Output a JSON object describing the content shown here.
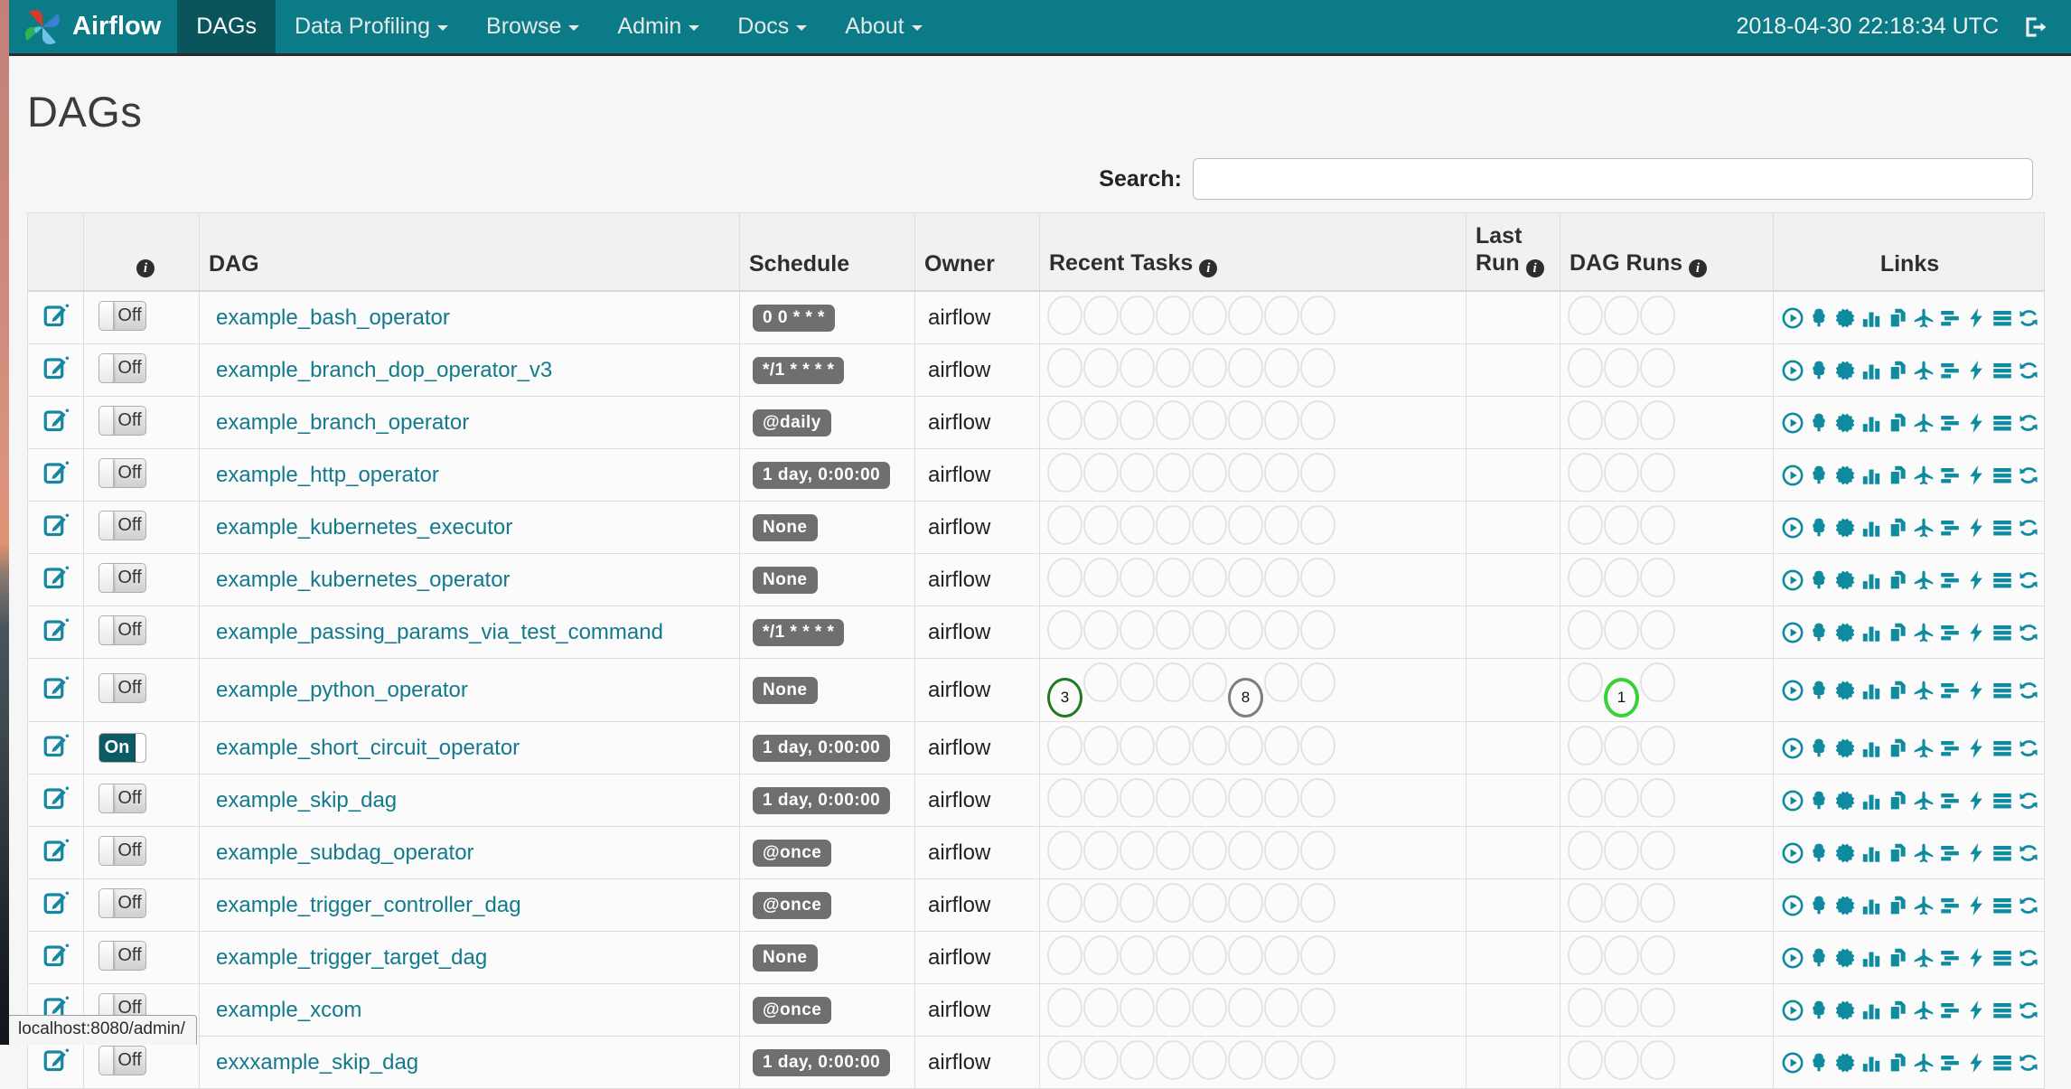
{
  "navbar": {
    "brand": "Airflow",
    "items": [
      {
        "label": "DAGs",
        "active": true,
        "caret": false
      },
      {
        "label": "Data Profiling",
        "active": false,
        "caret": true
      },
      {
        "label": "Browse",
        "active": false,
        "caret": true
      },
      {
        "label": "Admin",
        "active": false,
        "caret": true
      },
      {
        "label": "Docs",
        "active": false,
        "caret": true
      },
      {
        "label": "About",
        "active": false,
        "caret": true
      }
    ],
    "clock": "2018-04-30 22:18:34 UTC",
    "logout_icon": "logout-icon"
  },
  "page": {
    "title": "DAGs",
    "search_label": "Search:",
    "search_value": "",
    "search_placeholder": "",
    "status_bar": "localhost:8080/admin/"
  },
  "colors": {
    "navbar_teal": "#0b7c87",
    "navbar_active": "#0a545c",
    "link_teal": "#127a8c",
    "icon_teal": "#0f8ba0",
    "badge_gray": "#6f6f6f",
    "success_green": "#1f7a1f",
    "shutdown_gray": "#7d7d7d",
    "running_green": "#38d138"
  },
  "table": {
    "headers": {
      "info": "i",
      "dag": "DAG",
      "schedule": "Schedule",
      "owner": "Owner",
      "recent_tasks": "Recent Tasks",
      "last_run_line1": "Last",
      "last_run_line2": "Run",
      "dag_runs": "DAG Runs",
      "links": "Links"
    },
    "link_icons": [
      "trigger",
      "tree",
      "graph",
      "duration",
      "tries",
      "landing",
      "gantt",
      "code",
      "logs",
      "refresh"
    ],
    "recent_task_slots": 8,
    "dag_run_slots": 3,
    "rows": [
      {
        "name": "example_bash_operator",
        "toggle": "Off",
        "schedule": "0 0 * * *",
        "owner": "airflow",
        "last_run": "",
        "recent_tasks": [
          null,
          null,
          null,
          null,
          null,
          null,
          null,
          null
        ],
        "dag_runs": [
          null,
          null,
          null
        ]
      },
      {
        "name": "example_branch_dop_operator_v3",
        "toggle": "Off",
        "schedule": "*/1 * * * *",
        "owner": "airflow",
        "last_run": "",
        "recent_tasks": [
          null,
          null,
          null,
          null,
          null,
          null,
          null,
          null
        ],
        "dag_runs": [
          null,
          null,
          null
        ]
      },
      {
        "name": "example_branch_operator",
        "toggle": "Off",
        "schedule": "@daily",
        "owner": "airflow",
        "last_run": "",
        "recent_tasks": [
          null,
          null,
          null,
          null,
          null,
          null,
          null,
          null
        ],
        "dag_runs": [
          null,
          null,
          null
        ]
      },
      {
        "name": "example_http_operator",
        "toggle": "Off",
        "schedule": "1 day, 0:00:00",
        "owner": "airflow",
        "last_run": "",
        "recent_tasks": [
          null,
          null,
          null,
          null,
          null,
          null,
          null,
          null
        ],
        "dag_runs": [
          null,
          null,
          null
        ]
      },
      {
        "name": "example_kubernetes_executor",
        "toggle": "Off",
        "schedule": "None",
        "owner": "airflow",
        "last_run": "",
        "recent_tasks": [
          null,
          null,
          null,
          null,
          null,
          null,
          null,
          null
        ],
        "dag_runs": [
          null,
          null,
          null
        ]
      },
      {
        "name": "example_kubernetes_operator",
        "toggle": "Off",
        "schedule": "None",
        "owner": "airflow",
        "last_run": "",
        "recent_tasks": [
          null,
          null,
          null,
          null,
          null,
          null,
          null,
          null
        ],
        "dag_runs": [
          null,
          null,
          null
        ]
      },
      {
        "name": "example_passing_params_via_test_command",
        "toggle": "Off",
        "schedule": "*/1 * * * *",
        "owner": "airflow",
        "last_run": "",
        "recent_tasks": [
          null,
          null,
          null,
          null,
          null,
          null,
          null,
          null
        ],
        "dag_runs": [
          null,
          null,
          null
        ]
      },
      {
        "name": "example_python_operator",
        "toggle": "Off",
        "schedule": "None",
        "owner": "airflow",
        "last_run": "",
        "recent_tasks": [
          {
            "value": "3",
            "state": "success"
          },
          null,
          null,
          null,
          null,
          {
            "value": "8",
            "state": "shutdown"
          },
          null,
          null
        ],
        "dag_runs": [
          null,
          {
            "value": "1",
            "state": "running"
          },
          null
        ]
      },
      {
        "name": "example_short_circuit_operator",
        "toggle": "On",
        "schedule": "1 day, 0:00:00",
        "owner": "airflow",
        "last_run": "",
        "recent_tasks": [
          null,
          null,
          null,
          null,
          null,
          null,
          null,
          null
        ],
        "dag_runs": [
          null,
          null,
          null
        ]
      },
      {
        "name": "example_skip_dag",
        "toggle": "Off",
        "schedule": "1 day, 0:00:00",
        "owner": "airflow",
        "last_run": "",
        "recent_tasks": [
          null,
          null,
          null,
          null,
          null,
          null,
          null,
          null
        ],
        "dag_runs": [
          null,
          null,
          null
        ]
      },
      {
        "name": "example_subdag_operator",
        "toggle": "Off",
        "schedule": "@once",
        "owner": "airflow",
        "last_run": "",
        "recent_tasks": [
          null,
          null,
          null,
          null,
          null,
          null,
          null,
          null
        ],
        "dag_runs": [
          null,
          null,
          null
        ]
      },
      {
        "name": "example_trigger_controller_dag",
        "toggle": "Off",
        "schedule": "@once",
        "owner": "airflow",
        "last_run": "",
        "recent_tasks": [
          null,
          null,
          null,
          null,
          null,
          null,
          null,
          null
        ],
        "dag_runs": [
          null,
          null,
          null
        ]
      },
      {
        "name": "example_trigger_target_dag",
        "toggle": "Off",
        "schedule": "None",
        "owner": "airflow",
        "last_run": "",
        "recent_tasks": [
          null,
          null,
          null,
          null,
          null,
          null,
          null,
          null
        ],
        "dag_runs": [
          null,
          null,
          null
        ]
      },
      {
        "name": "example_xcom",
        "toggle": "Off",
        "schedule": "@once",
        "owner": "airflow",
        "last_run": "",
        "recent_tasks": [
          null,
          null,
          null,
          null,
          null,
          null,
          null,
          null
        ],
        "dag_runs": [
          null,
          null,
          null
        ]
      },
      {
        "name": "exxxample_skip_dag",
        "toggle": "Off",
        "schedule": "1 day, 0:00:00",
        "owner": "airflow",
        "last_run": "",
        "recent_tasks": [
          null,
          null,
          null,
          null,
          null,
          null,
          null,
          null
        ],
        "dag_runs": [
          null,
          null,
          null
        ]
      }
    ]
  }
}
